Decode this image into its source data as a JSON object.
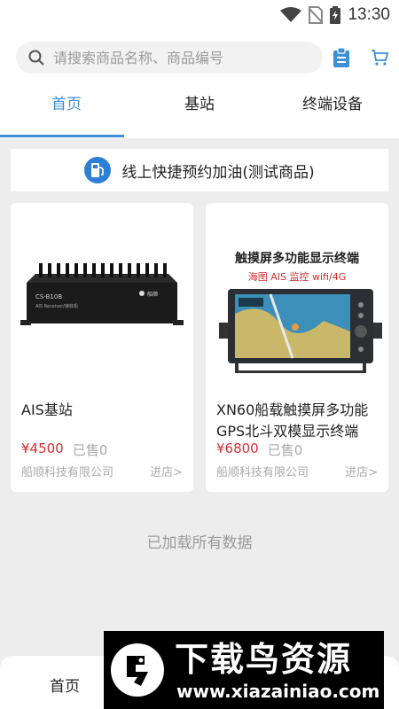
{
  "status_bar": {
    "time": "13:30"
  },
  "search": {
    "placeholder": "请搜索商品名称、商品编号"
  },
  "tabs": [
    {
      "label": "首页",
      "active": true
    },
    {
      "label": "基站",
      "active": false
    },
    {
      "label": "终端设备",
      "active": false
    }
  ],
  "banner": {
    "text": "线上快捷预约加油(测试商品)",
    "icon": "fuel-pump-icon"
  },
  "products": [
    {
      "name": "AIS基站",
      "price": "¥4500",
      "sold": "已售0",
      "shop": "船顺科技有限公司",
      "enter": "进店>",
      "image_labels": {
        "model": "CS-B10B",
        "desc": "AIS Receiver/接收机",
        "brand": "船顺"
      }
    },
    {
      "name": "XN60船载触摸屏多功能GPS北斗双模显示终端",
      "price": "¥6800",
      "sold": "已售0",
      "shop": "船顺科技有限公司",
      "enter": "进店>",
      "image_labels": {
        "headline": "触摸屏多功能显示终端",
        "subline": "海图 AIS 监控 wifi/4G"
      }
    }
  ],
  "footer_text": "已加载所有数据",
  "bottom_nav": {
    "home_label": "首页"
  },
  "watermark": {
    "title": "下载鸟资源",
    "url": "www.xiazainiao.com"
  },
  "colors": {
    "accent": "#3d8fd6",
    "price": "#d32f2f",
    "banner_icon": "#2d7fd6"
  }
}
